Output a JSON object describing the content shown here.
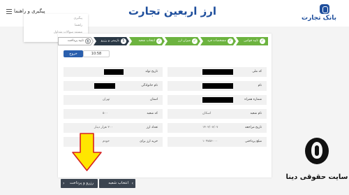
{
  "header": {
    "bank_name": "بانک تجارت",
    "app_title": "ارز اربعین تجارت",
    "tracking_link": "پیگیری و راهنما",
    "menu_items": [
      "پیگیری",
      "راهنما",
      "مستند سوالات متداول"
    ]
  },
  "steps": [
    {
      "label": "تایید قوانین",
      "state": "done"
    },
    {
      "label": "مشخصات فرد",
      "state": "done"
    },
    {
      "label": "میزان ارز",
      "state": "done"
    },
    {
      "label": "انتخاب شعبه",
      "state": "done"
    },
    {
      "label": "بازبینی و رزرو",
      "state": "active",
      "num": "5"
    },
    {
      "label": "تایید پرداخت",
      "state": "pending",
      "num": "6"
    }
  ],
  "timer": "10:58",
  "exit_label": "خروج",
  "fields": {
    "right": [
      {
        "label": "کد ملی",
        "value": "",
        "redacted": true
      },
      {
        "label": "نام",
        "value": "",
        "redacted": true
      },
      {
        "label": "شماره همراه",
        "value": "",
        "redacted": true
      },
      {
        "label": "نام شعبه",
        "value": "اسکان",
        "redacted": false
      },
      {
        "label": "تاریخ مراجعه",
        "value": "۱۴۰۲/۰۷/۰۷",
        "redacted": false
      },
      {
        "label": "مبلغ پرداختی",
        "value": "۱۰۹۷۵۶۰۰۰",
        "redacted": false
      }
    ],
    "left": [
      {
        "label": "تاریخ تولد",
        "value": "",
        "redacted": true
      },
      {
        "label": "نام خانوادگی",
        "value": "",
        "redacted": true
      },
      {
        "label": "استان",
        "value": "تهران",
        "redacted": false
      },
      {
        "label": "کد شعبه",
        "value": "۵۰۰",
        "redacted": false
      },
      {
        "label": "تعداد ارز",
        "value": "۲۰۰ هزار دینار",
        "redacted": false
      },
      {
        "label": "خرید ارز برای",
        "value": "خودم",
        "redacted": false
      }
    ]
  },
  "actions": {
    "back_label": "انتخاب شعبه",
    "submit_label": "رزرو و پرداخت"
  },
  "watermark": "سایت حقوقی دینا",
  "colors": {
    "brand_blue": "#1e4e9c",
    "step_done": "#6cb33f",
    "step_active": "#2a3845",
    "button_dark": "#3b4450",
    "arrow_fill": "#ffe600",
    "arrow_stroke": "#d62020"
  },
  "icons": {
    "bank": "bank-logo-icon",
    "menu": "hamburger-icon",
    "step_done": "check-icon",
    "next": "chevron-left-icon",
    "back": "chevron-right-icon",
    "arrow": "down-arrow-icon"
  }
}
